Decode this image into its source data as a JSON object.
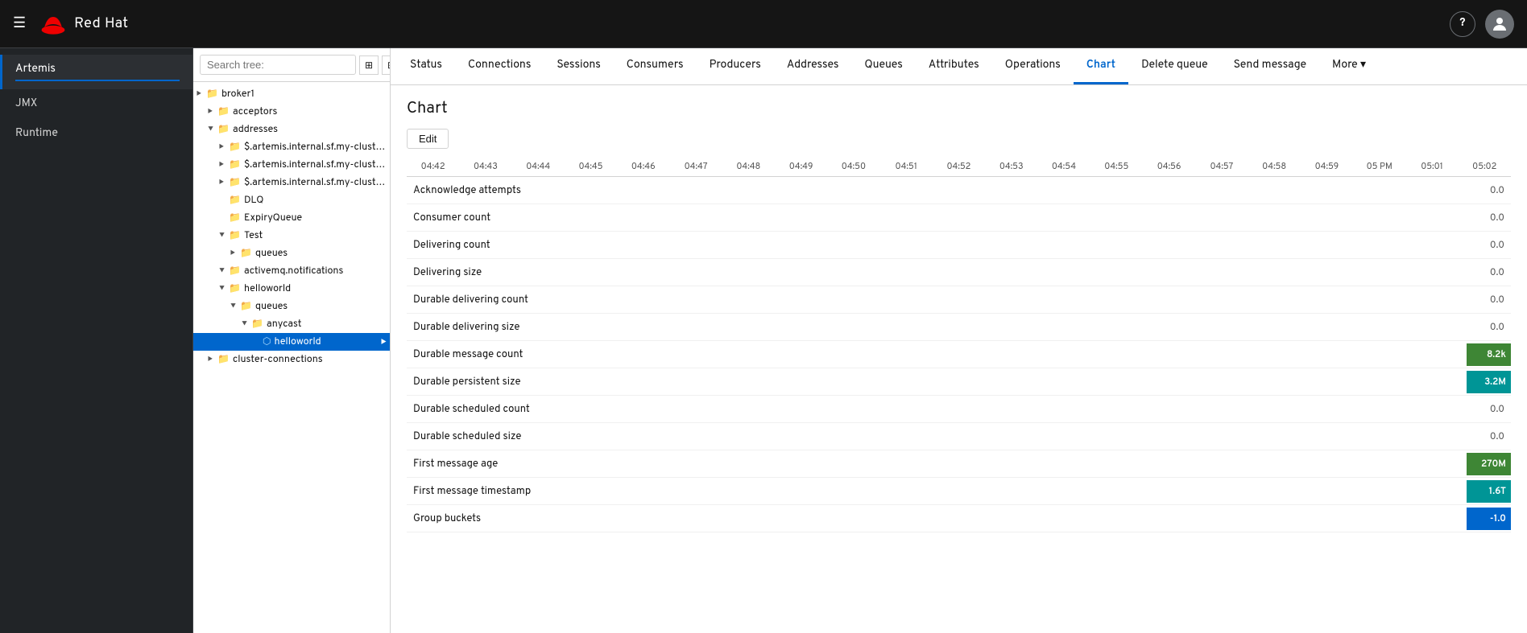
{
  "topbar": {
    "brand": "Red Hat",
    "help_label": "?",
    "hamburger": "☰"
  },
  "sidebar": {
    "items": [
      {
        "id": "artemis",
        "label": "Artemis",
        "active": true
      },
      {
        "id": "jmx",
        "label": "JMX",
        "active": false
      },
      {
        "id": "runtime",
        "label": "Runtime",
        "active": false
      }
    ]
  },
  "tree": {
    "search_placeholder": "Search tree:",
    "nodes": [
      {
        "id": "broker1",
        "label": "broker1",
        "level": 0,
        "type": "folder",
        "expanded": true
      },
      {
        "id": "acceptors",
        "label": "acceptors",
        "level": 1,
        "type": "folder",
        "expanded": false
      },
      {
        "id": "addresses",
        "label": "addresses",
        "level": 1,
        "type": "folder",
        "expanded": true
      },
      {
        "id": "artemis1",
        "label": "$.artemis.internal.sf.my-cluster....",
        "level": 2,
        "type": "folder",
        "expanded": false
      },
      {
        "id": "artemis2",
        "label": "$.artemis.internal.sf.my-cluster....",
        "level": 2,
        "type": "folder",
        "expanded": false
      },
      {
        "id": "artemis3",
        "label": "$.artemis.internal.sf.my-cluster....",
        "level": 2,
        "type": "folder",
        "expanded": false
      },
      {
        "id": "DLQ",
        "label": "DLQ",
        "level": 2,
        "type": "folder",
        "expanded": false
      },
      {
        "id": "ExpiryQueue",
        "label": "ExpiryQueue",
        "level": 2,
        "type": "folder",
        "expanded": false
      },
      {
        "id": "Test",
        "label": "Test",
        "level": 2,
        "type": "folder",
        "expanded": true
      },
      {
        "id": "test-queues",
        "label": "queues",
        "level": 3,
        "type": "folder",
        "expanded": false
      },
      {
        "id": "activemq",
        "label": "activemq.notifications",
        "level": 2,
        "type": "folder",
        "expanded": false
      },
      {
        "id": "helloworld",
        "label": "helloworld",
        "level": 2,
        "type": "folder",
        "expanded": true
      },
      {
        "id": "hw-queues",
        "label": "queues",
        "level": 3,
        "type": "folder",
        "expanded": true
      },
      {
        "id": "anycast",
        "label": "anycast",
        "level": 4,
        "type": "folder",
        "expanded": true
      },
      {
        "id": "helloworld-queue",
        "label": "helloworld",
        "level": 5,
        "type": "queue",
        "selected": true
      },
      {
        "id": "cluster-connections",
        "label": "cluster-connections",
        "level": 1,
        "type": "folder",
        "expanded": false
      }
    ]
  },
  "tabs": [
    {
      "id": "status",
      "label": "Status",
      "active": false
    },
    {
      "id": "connections",
      "label": "Connections",
      "active": false
    },
    {
      "id": "sessions",
      "label": "Sessions",
      "active": false
    },
    {
      "id": "consumers",
      "label": "Consumers",
      "active": false
    },
    {
      "id": "producers",
      "label": "Producers",
      "active": false
    },
    {
      "id": "addresses",
      "label": "Addresses",
      "active": false
    },
    {
      "id": "queues",
      "label": "Queues",
      "active": false
    },
    {
      "id": "attributes",
      "label": "Attributes",
      "active": false
    },
    {
      "id": "operations",
      "label": "Operations",
      "active": false
    },
    {
      "id": "chart",
      "label": "Chart",
      "active": true
    },
    {
      "id": "delete-queue",
      "label": "Delete queue",
      "active": false
    },
    {
      "id": "send-message",
      "label": "Send message",
      "active": false
    },
    {
      "id": "more",
      "label": "More ▾",
      "active": false
    }
  ],
  "chart": {
    "title": "Chart",
    "edit_button": "Edit",
    "time_labels": [
      "04:42",
      "04:43",
      "04:44",
      "04:45",
      "04:46",
      "04:47",
      "04:48",
      "04:49",
      "04:50",
      "04:51",
      "04:52",
      "04:53",
      "04:54",
      "04:55",
      "04:56",
      "04:57",
      "04:58",
      "04:59",
      "05 PM",
      "05:01",
      "05:02"
    ],
    "metrics": [
      {
        "name": "Acknowledge attempts",
        "value": "0.0",
        "bar": null
      },
      {
        "name": "Consumer count",
        "value": "0.0",
        "bar": null
      },
      {
        "name": "Delivering count",
        "value": "0.0",
        "bar": null
      },
      {
        "name": "Delivering size",
        "value": "0.0",
        "bar": null
      },
      {
        "name": "Durable delivering count",
        "value": "0.0",
        "bar": null
      },
      {
        "name": "Durable delivering size",
        "value": "0.0",
        "bar": null
      },
      {
        "name": "Durable message count",
        "value": "8.2k",
        "bar": "green"
      },
      {
        "name": "Durable persistent size",
        "value": "3.2M",
        "bar": "teal"
      },
      {
        "name": "Durable scheduled count",
        "value": "0.0",
        "bar": null
      },
      {
        "name": "Durable scheduled size",
        "value": "0.0",
        "bar": null
      },
      {
        "name": "First message age",
        "value": "270M",
        "bar": "green"
      },
      {
        "name": "First message timestamp",
        "value": "1.6T",
        "bar": "teal"
      },
      {
        "name": "Group buckets",
        "value": "-1.0",
        "bar": "blue"
      }
    ]
  }
}
